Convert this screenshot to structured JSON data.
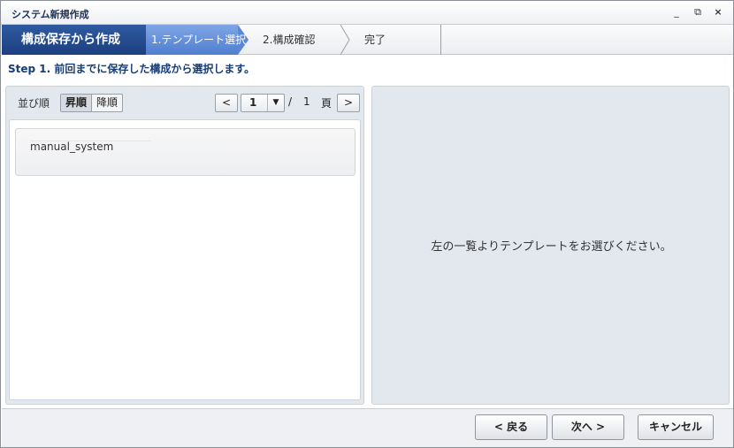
{
  "window": {
    "title": "システム新規作成",
    "controls": {
      "minimize": "_",
      "restore": "⧉",
      "close": "×"
    }
  },
  "wizard": {
    "main_step": "構成保存から作成",
    "steps": [
      {
        "label": "1.テンプレート選択",
        "state": "active"
      },
      {
        "label": "2.構成確認",
        "state": "pending"
      },
      {
        "label": "完了",
        "state": "pending"
      }
    ]
  },
  "instruction": "Step 1. 前回までに保存した構成から選択します。",
  "left_panel": {
    "sort": {
      "label": "並び順",
      "options": [
        "昇順",
        "降順"
      ],
      "selected": "昇順"
    },
    "pagination": {
      "prev_icon": "<",
      "next_icon": ">",
      "current_page": "1",
      "dropdown_icon": "▼",
      "separator": "/",
      "total_pages": "1",
      "unit": "頁"
    },
    "items": [
      {
        "name": "manual_system"
      }
    ]
  },
  "right_panel": {
    "message": "左の一覧よりテンプレートをお選びください。"
  },
  "footer": {
    "back_label": "< 戻る",
    "next_label": "次へ >",
    "cancel_label": "キャンセル"
  },
  "colors": {
    "accent_dark": "#1c3f80",
    "accent_step": "#5a88d6",
    "panel_bg": "#e3e7ee",
    "instruction_text": "#163d75"
  }
}
